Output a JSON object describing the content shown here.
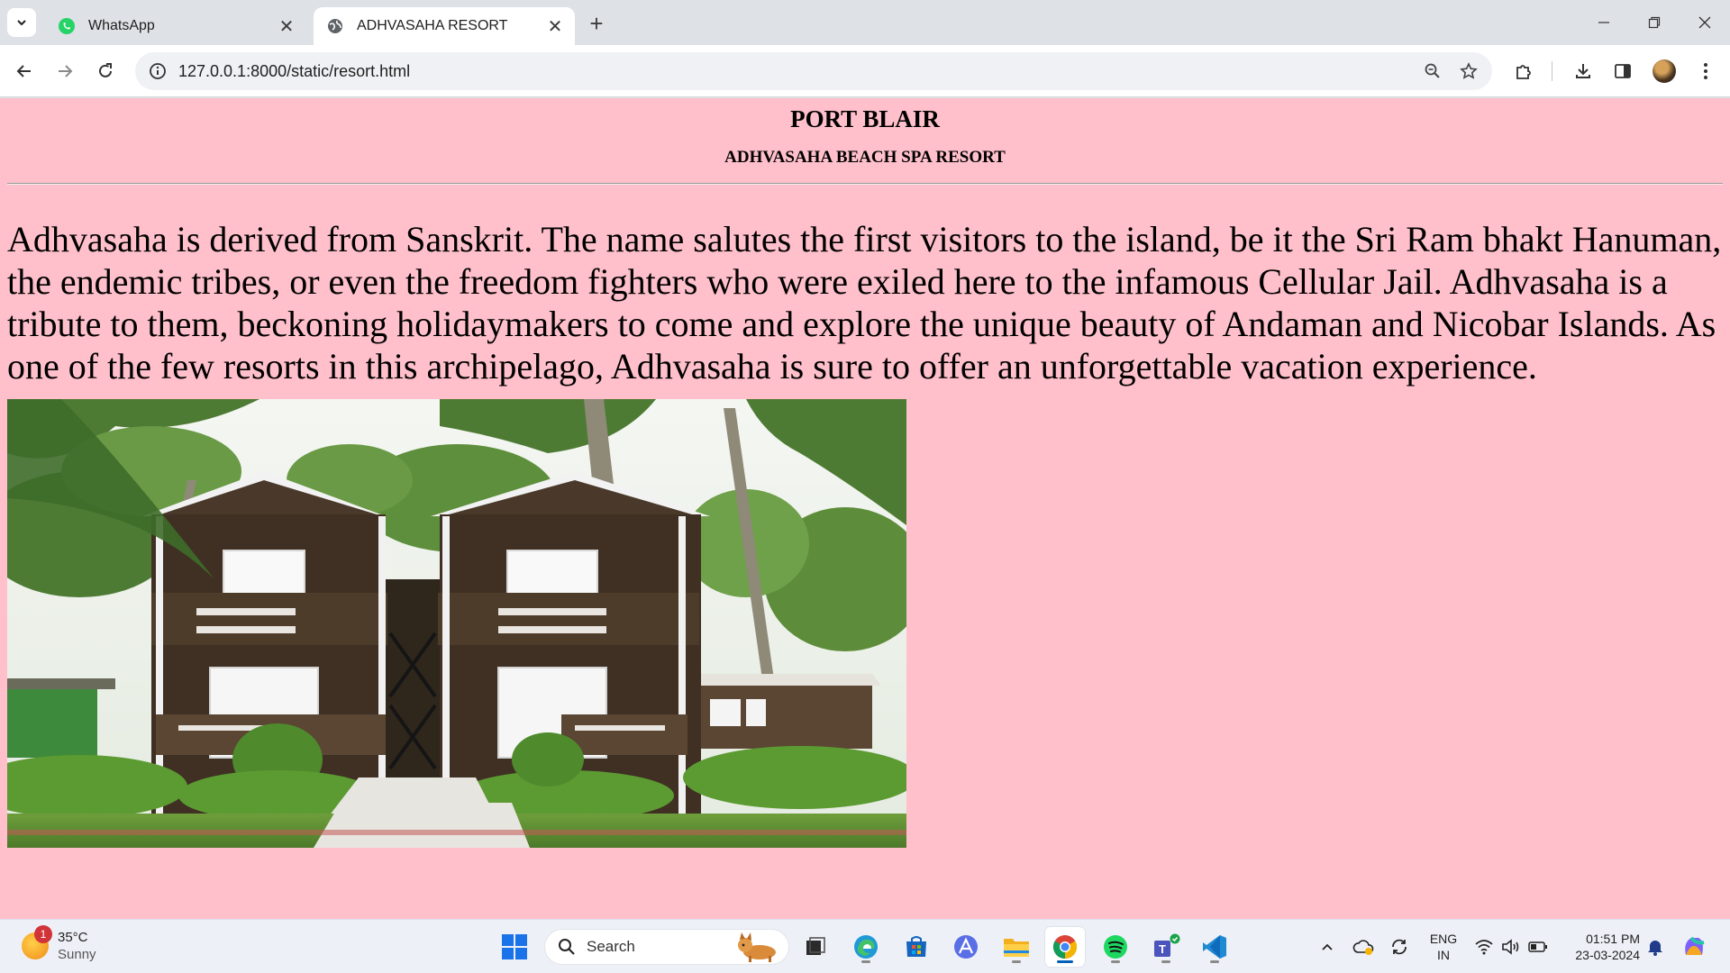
{
  "browser": {
    "tabs": [
      {
        "title": "WhatsApp",
        "active": false,
        "favicon": "whatsapp-icon"
      },
      {
        "title": "ADHVASAHA RESORT",
        "active": true,
        "favicon": "globe-icon"
      }
    ],
    "url": "127.0.0.1:8000/static/resort.html"
  },
  "page": {
    "heading": "PORT BLAIR",
    "subheading": "ADHVASAHA BEACH SPA RESORT",
    "paragraph": "Adhvasaha is derived from Sanskrit. The name salutes the first visitors to the island, be it the Sri Ram bhakt Hanuman, the endemic tribes, or even the freedom fighters who were exiled here to the infamous Cellular Jail. Adhvasaha is a tribute to them, beckoning holidaymakers to come and explore the unique beauty of Andaman and Nicobar Islands. As one of the few resorts in this archipelago, Adhvasaha is sure to offer an unforgettable vacation experience.",
    "background_color": "#ffc0cb"
  },
  "taskbar": {
    "weather": {
      "temp": "35°C",
      "condition": "Sunny",
      "badge": "1"
    },
    "search_placeholder": "Search",
    "language": {
      "line1": "ENG",
      "line2": "IN"
    },
    "time": "01:51 PM",
    "date": "23-03-2024"
  }
}
